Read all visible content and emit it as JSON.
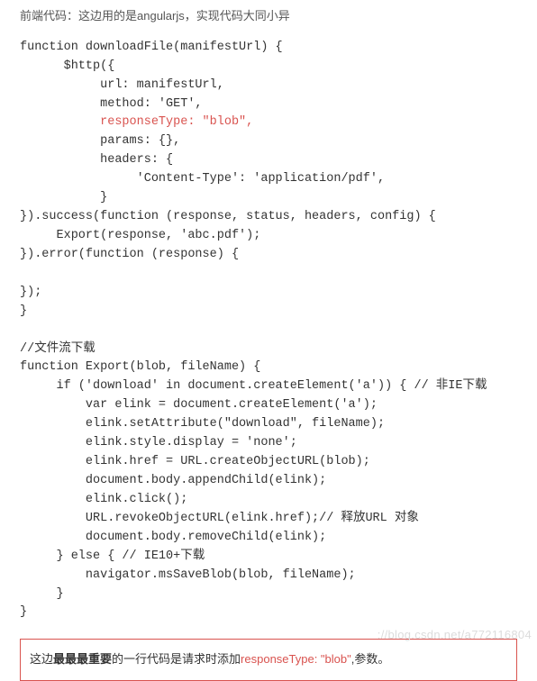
{
  "intro": "前端代码：这边用的是angularjs，实现代码大同小异",
  "code": {
    "l01": "function downloadFile(manifestUrl) {",
    "l02": "      $http({",
    "l03": "           url: manifestUrl,",
    "l04": "           method: 'GET',",
    "l05_hl": "           responseType: \"blob\",",
    "l06": "           params: {},",
    "l07": "           headers: {",
    "l08": "                'Content-Type': 'application/pdf',",
    "l09": "           }",
    "l10": "}).success(function (response, status, headers, config) {",
    "l11": "     Export(response, 'abc.pdf');",
    "l12": "}).error(function (response) {",
    "l13": "",
    "l14": "});",
    "l15": "}",
    "l16": "",
    "l17": "//文件流下载",
    "l18": "function Export(blob, fileName) {",
    "l19": "     if ('download' in document.createElement('a')) { // 非IE下载",
    "l20": "         var elink = document.createElement('a');",
    "l21": "         elink.setAttribute(\"download\", fileName);",
    "l22": "         elink.style.display = 'none';",
    "l23": "         elink.href = URL.createObjectURL(blob);",
    "l24": "         document.body.appendChild(elink);",
    "l25": "         elink.click();",
    "l26": "         URL.revokeObjectURL(elink.href);// 释放URL 对象",
    "l27": "         document.body.removeChild(elink);",
    "l28": "     } else { // IE10+下载",
    "l29": "         navigator.msSaveBlob(blob, fileName);",
    "l30": "     }",
    "l31": "}"
  },
  "note": {
    "prefix": "这边",
    "bold": "最最最重要",
    "mid": "的一行代码是请求时添加",
    "hl": "responseType: \"blob\"",
    "suffix": ",参数。"
  },
  "watermark": "://blog.csdn.net/a772116804"
}
